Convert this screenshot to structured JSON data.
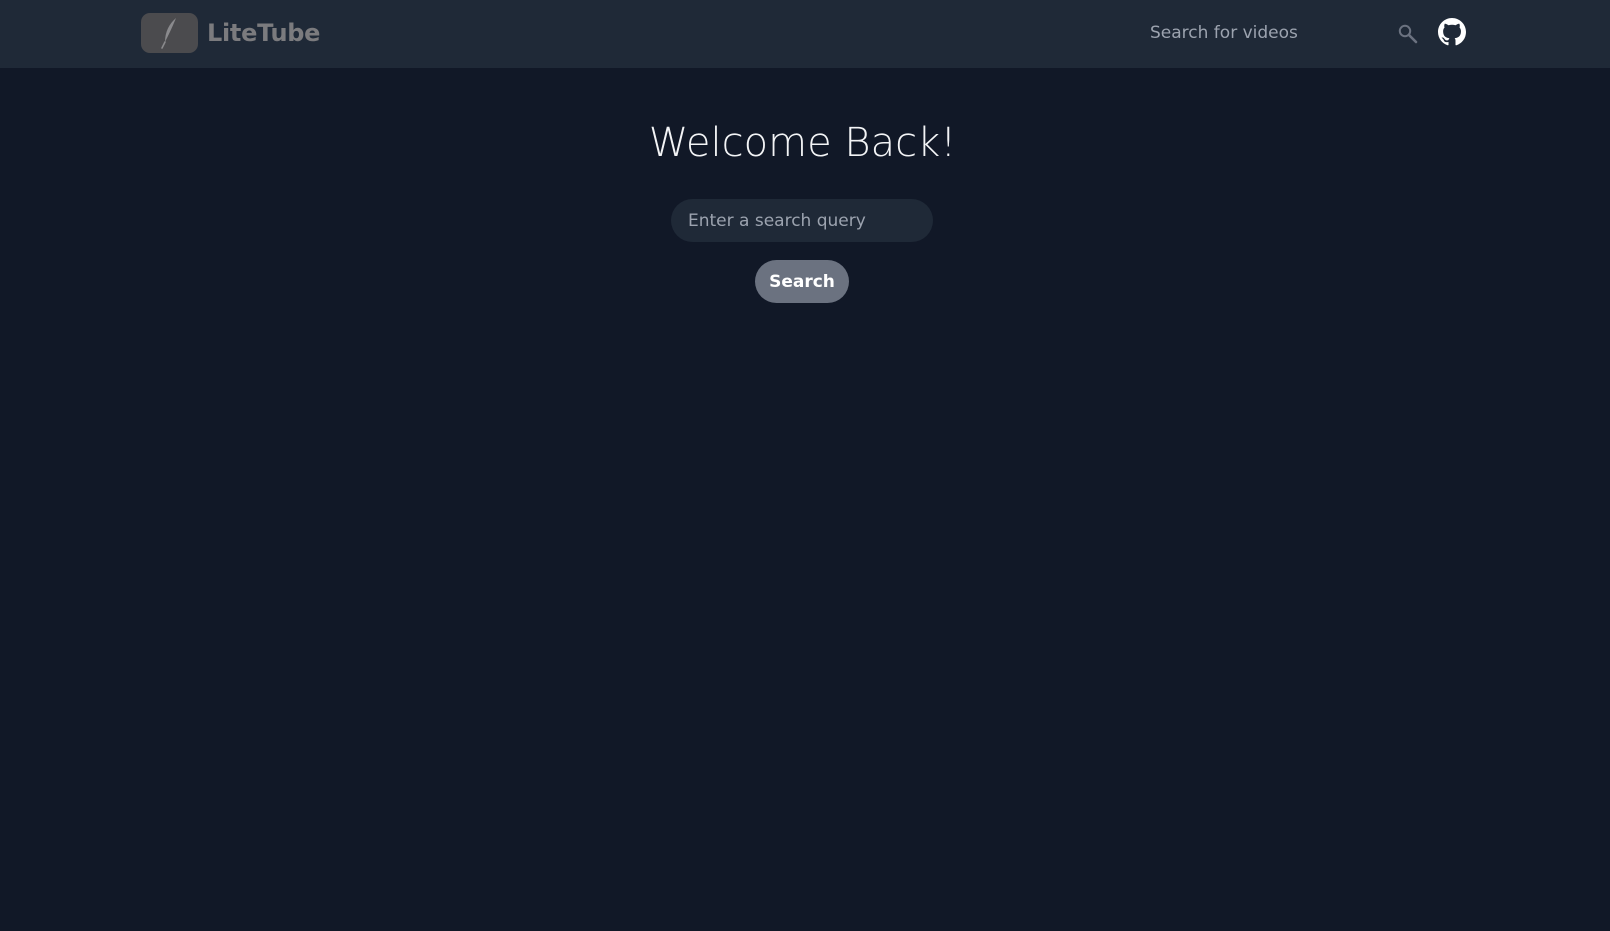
{
  "navbar": {
    "brand_name": "LiteTube",
    "search": {
      "placeholder": "Search for videos"
    },
    "icons": {
      "logo": "feather-icon",
      "search": "magnifier-icon",
      "github": "github-icon"
    }
  },
  "main": {
    "title": "Welcome Back!",
    "search": {
      "placeholder": "Enter a search query"
    },
    "search_button_label": "Search"
  },
  "colors": {
    "page_background": "#111827",
    "navbar_background": "#1f2937",
    "input_background": "#1f2937",
    "button_background": "#6b7280",
    "logo_background": "#4b4b4e"
  }
}
